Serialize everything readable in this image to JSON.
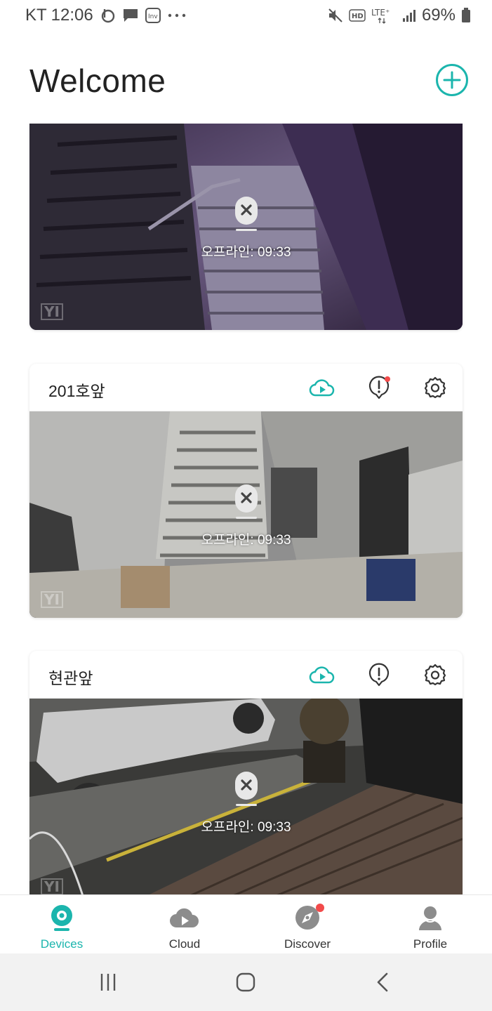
{
  "status_bar": {
    "carrier": "KT",
    "time": "12:06",
    "battery": "69%",
    "icons_left": [
      "b-app-icon",
      "message-icon",
      "inv-app-icon",
      "more-icon"
    ],
    "icons_right": [
      "mute-icon",
      "hd-icon",
      "lte-icon",
      "signal-icon",
      "battery-icon"
    ],
    "lte_label": "LTE⁺",
    "hd_label": "HD"
  },
  "header": {
    "title": "Welcome",
    "add_icon": "plus-circle-icon"
  },
  "colors": {
    "accent": "#1bb5ad",
    "alert": "#f24a4a"
  },
  "devices": [
    {
      "name": "",
      "offline_text": "오프라인: 09:33",
      "logo_text": "YI"
    },
    {
      "name": "201호앞",
      "offline_text": "오프라인: 09:33",
      "logo_text": "YI",
      "has_alert": true
    },
    {
      "name": "현관앞",
      "offline_text": "오프라인: 09:33",
      "logo_text": "YI",
      "has_alert": false
    }
  ],
  "nav": {
    "items": [
      {
        "label": "Devices",
        "icon": "camera-icon",
        "active": true
      },
      {
        "label": "Cloud",
        "icon": "cloud-icon",
        "active": false
      },
      {
        "label": "Discover",
        "icon": "compass-icon",
        "active": false,
        "badge": true
      },
      {
        "label": "Profile",
        "icon": "user-icon",
        "active": false
      }
    ]
  },
  "system_nav": [
    "recents-icon",
    "home-icon",
    "back-icon"
  ]
}
